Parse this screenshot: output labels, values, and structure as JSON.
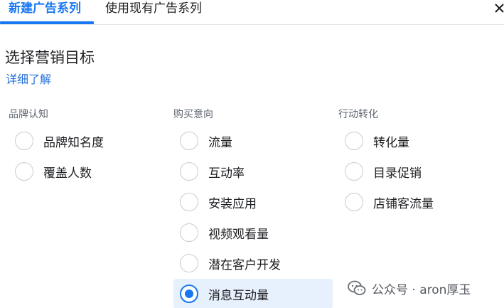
{
  "tabs": [
    {
      "label": "新建广告系列",
      "active": true
    },
    {
      "label": "使用现有广告系列",
      "active": false
    }
  ],
  "icons": {
    "close": "close-icon",
    "watermark": "wechat-icon"
  },
  "header": {
    "title": "选择营销目标",
    "learn_more": "详细了解"
  },
  "columns": [
    {
      "title": "品牌认知",
      "options": [
        {
          "label": "品牌知名度",
          "selected": false
        },
        {
          "label": "覆盖人数",
          "selected": false
        }
      ]
    },
    {
      "title": "购买意向",
      "options": [
        {
          "label": "流量",
          "selected": false
        },
        {
          "label": "互动率",
          "selected": false
        },
        {
          "label": "安装应用",
          "selected": false
        },
        {
          "label": "视频观看量",
          "selected": false
        },
        {
          "label": "潜在客户开发",
          "selected": false
        },
        {
          "label": "消息互动量",
          "selected": true
        }
      ]
    },
    {
      "title": "行动转化",
      "options": [
        {
          "label": "转化量",
          "selected": false
        },
        {
          "label": "目录促销",
          "selected": false
        },
        {
          "label": "店铺客流量",
          "selected": false
        }
      ]
    }
  ],
  "watermark": {
    "text": "公众号 · aron厚玉"
  },
  "colors": {
    "accent": "#1877f2",
    "selected_bg": "#e7f0fd",
    "link": "#216fdb"
  }
}
